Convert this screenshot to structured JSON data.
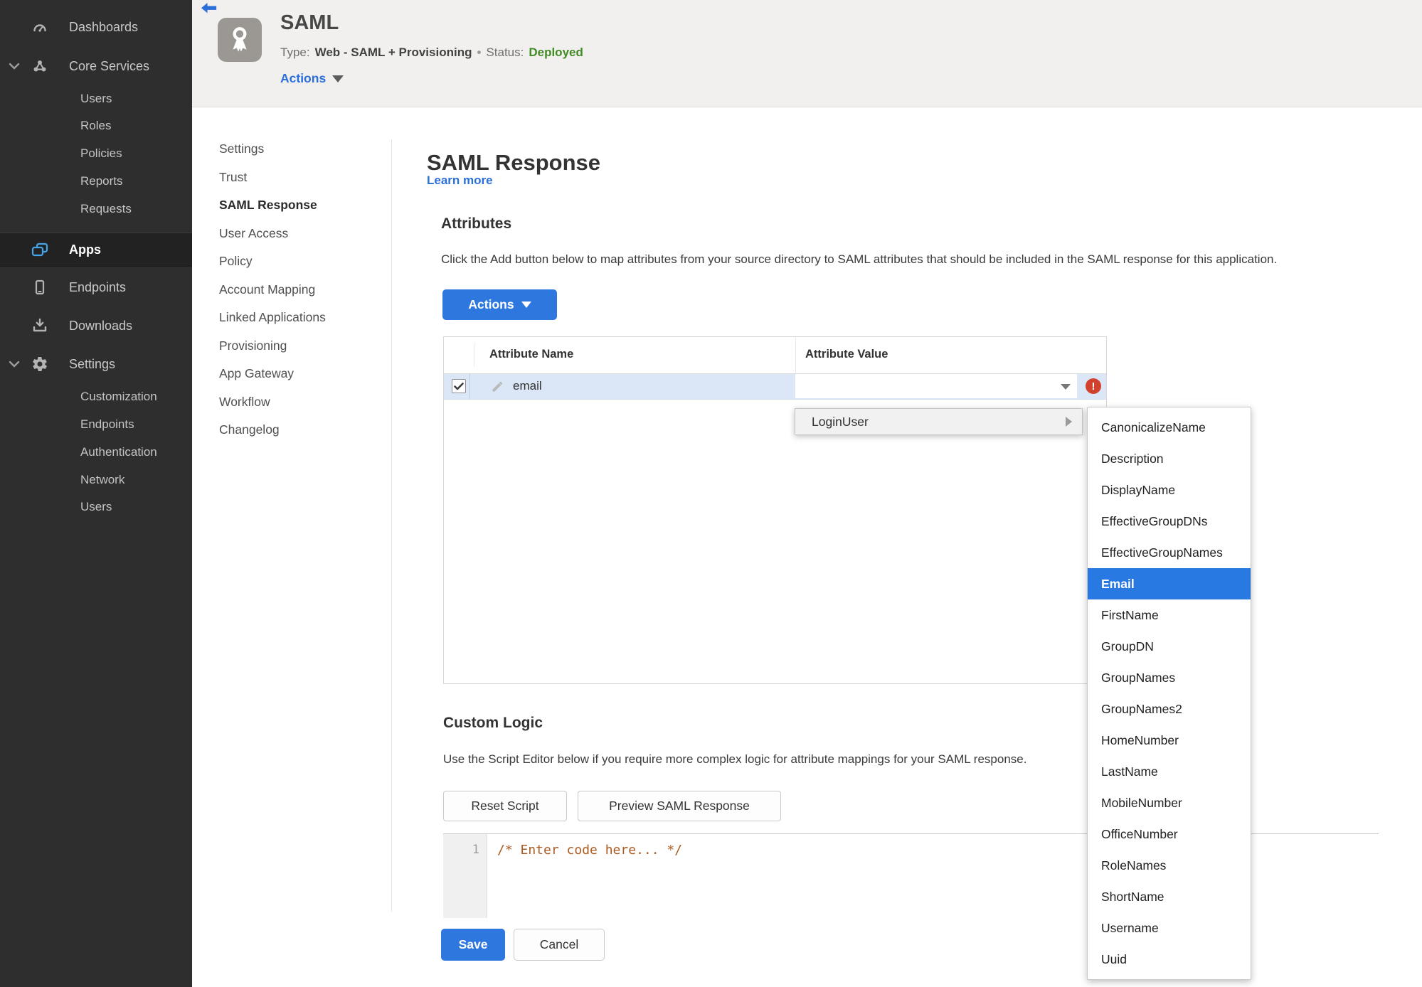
{
  "sidebar": {
    "items": [
      {
        "label": "Dashboards",
        "icon": "gauge"
      },
      {
        "label": "Core Services",
        "icon": "core-services",
        "expandable": true
      },
      {
        "label": "Users",
        "sub": true
      },
      {
        "label": "Roles",
        "sub": true
      },
      {
        "label": "Policies",
        "sub": true
      },
      {
        "label": "Reports",
        "sub": true
      },
      {
        "label": "Requests",
        "sub": true
      },
      {
        "label": "Apps",
        "icon": "apps",
        "active": true
      },
      {
        "label": "Endpoints",
        "icon": "device"
      },
      {
        "label": "Downloads",
        "icon": "download"
      },
      {
        "label": "Settings",
        "icon": "gear",
        "expandable": true
      },
      {
        "label": "Customization",
        "sub": true
      },
      {
        "label": "Endpoints",
        "sub": true
      },
      {
        "label": "Authentication",
        "sub": true
      },
      {
        "label": "Network",
        "sub": true
      },
      {
        "label": "Users",
        "sub": true
      }
    ]
  },
  "header": {
    "title": "SAML",
    "type_label": "Type:",
    "type_value": "Web - SAML + Provisioning",
    "dot": "•",
    "status_label": "Status:",
    "status_value": "Deployed",
    "actions_label": "Actions"
  },
  "subnav": {
    "active": "SAML Response",
    "items": [
      "Settings",
      "Trust",
      "SAML Response",
      "User Access",
      "Policy",
      "Account Mapping",
      "Linked Applications",
      "Provisioning",
      "App Gateway",
      "Workflow",
      "Changelog"
    ]
  },
  "main": {
    "title": "SAML Response",
    "learn_more": "Learn more"
  },
  "attributes": {
    "heading": "Attributes",
    "description": "Click the Add button below to map attributes from your source directory to SAML attributes that should be included in the SAML response for this application.",
    "actions_label": "Actions",
    "table": {
      "columns": [
        "Attribute Name",
        "Attribute Value"
      ],
      "rows": [
        {
          "checked": true,
          "name": "email",
          "value": "",
          "error": true
        }
      ]
    }
  },
  "context_menu": {
    "label": "LoginUser"
  },
  "submenu": {
    "selected": "Email",
    "selected_index": 5,
    "items": [
      "CanonicalizeName",
      "Description",
      "DisplayName",
      "EffectiveGroupDNs",
      "EffectiveGroupNames",
      "Email",
      "FirstName",
      "GroupDN",
      "GroupNames",
      "GroupNames2",
      "HomeNumber",
      "LastName",
      "MobileNumber",
      "OfficeNumber",
      "RoleNames",
      "ShortName",
      "Username",
      "Uuid"
    ]
  },
  "custom_logic": {
    "heading": "Custom Logic",
    "description": "Use the Script Editor below if you require more complex logic for attribute mappings for your SAML response.",
    "reset_label": "Reset Script",
    "preview_label": "Preview SAML Response",
    "editor": {
      "line_number": "1",
      "code": "/* Enter code here... */"
    }
  },
  "footer": {
    "save_label": "Save",
    "cancel_label": "Cancel"
  },
  "colors": {
    "accent_blue": "#2e77de",
    "link_blue": "#2b6fdb",
    "status_green": "#428a26",
    "error_red": "#d2402e",
    "row_selection_blue": "#dbe7f6",
    "menu_selection_blue": "#2979e2",
    "sidebar_bg": "#2e2e2e",
    "apps_icon_blue": "#44a5e8",
    "header_bg": "#f1f0ee",
    "code_comment": "#ab5b20"
  }
}
